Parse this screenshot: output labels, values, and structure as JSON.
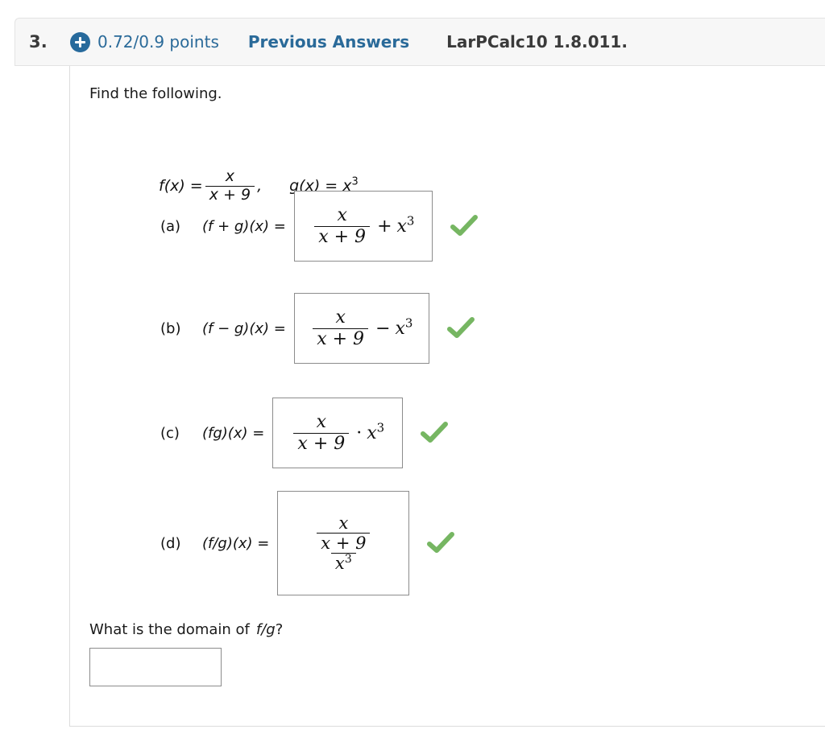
{
  "header": {
    "question_number": "3.",
    "plus_icon": "plus-circle-icon",
    "points": "0.72/0.9 points",
    "previous_answers_label": "Previous Answers",
    "textbook_reference": "LarPCalc10 1.8.011.",
    "link_color": "#2a6a99",
    "badge_color": "#276a9c",
    "background": "#f7f7f7"
  },
  "body": {
    "prompt": "Find the following.",
    "definitions": {
      "f_label": "f(x) =",
      "f_numerator": "x",
      "f_denominator": "x + 9",
      "comma": ",",
      "g_label": "g(x) =",
      "g_value_base": "x",
      "g_value_exponent": "3"
    },
    "parts": [
      {
        "label": "(a)",
        "expression": "(f + g)(x) =",
        "answer": {
          "numerator": "x",
          "denominator": "x + 9",
          "operator": "+",
          "term_base": "x",
          "term_exponent": "3"
        },
        "status": "correct",
        "status_icon": "green-check-icon"
      },
      {
        "label": "(b)",
        "expression": "(f − g)(x) =",
        "answer": {
          "numerator": "x",
          "denominator": "x + 9",
          "operator": "−",
          "term_base": "x",
          "term_exponent": "3"
        },
        "status": "correct",
        "status_icon": "green-check-icon"
      },
      {
        "label": "(c)",
        "expression": "(fg)(x) =",
        "answer": {
          "numerator": "x",
          "denominator": "x + 9",
          "operator": "·",
          "term_base": "x",
          "term_exponent": "3"
        },
        "status": "correct",
        "status_icon": "green-check-icon"
      },
      {
        "label": "(d)",
        "expression": "(f/g)(x) =",
        "answer": {
          "inner_numerator": "x",
          "inner_denominator": "x + 9",
          "outer_denominator_base": "x",
          "outer_denominator_exponent": "3"
        },
        "status": "correct",
        "status_icon": "green-check-icon"
      }
    ],
    "domain_question": {
      "text": "What is the domain of",
      "function": "f/g",
      "suffix": "?",
      "input_value": "",
      "input_placeholder": ""
    },
    "check_color": "#76b662"
  }
}
